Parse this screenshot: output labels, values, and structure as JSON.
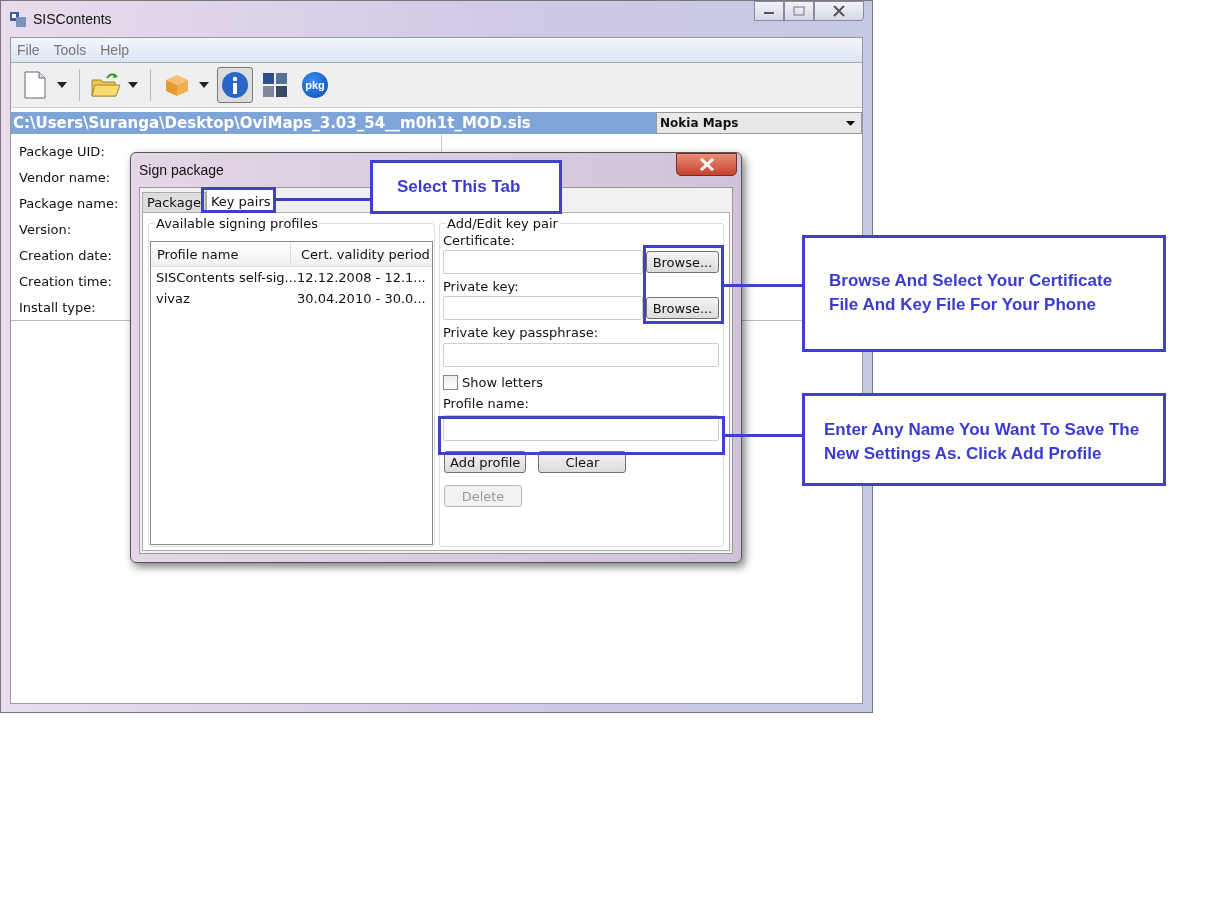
{
  "window": {
    "title": "SISContents",
    "menu": [
      "File",
      "Tools",
      "Help"
    ],
    "toolbar": [
      {
        "kind": "new",
        "dropdown": true,
        "pressed": false
      },
      {
        "kind": "open",
        "dropdown": true,
        "pressed": false
      },
      {
        "kind": "box",
        "dropdown": true,
        "pressed": false
      },
      {
        "kind": "info",
        "dropdown": false,
        "pressed": true
      },
      {
        "kind": "tiles",
        "dropdown": false,
        "pressed": false
      },
      {
        "kind": "pkg",
        "label": "pkg",
        "dropdown": false,
        "pressed": false
      }
    ],
    "path": "C:\\Users\\Suranga\\Desktop\\OviMaps_3.03_54__m0h1t_MOD.sis",
    "package_select": "Nokia Maps",
    "fields": [
      {
        "label": "Package UID:"
      },
      {
        "label": "Vendor name:"
      },
      {
        "label": "Package name:"
      },
      {
        "label": "Version:"
      },
      {
        "label": "Creation date:"
      },
      {
        "label": "Creation time:"
      },
      {
        "label": "Install type:"
      }
    ]
  },
  "dialog": {
    "title": "Sign package",
    "tabs": [
      {
        "label": "Package",
        "selected": false
      },
      {
        "label": "Key pairs",
        "selected": true
      }
    ],
    "profiles": {
      "title": "Available signing profiles",
      "columns": [
        "Profile name",
        "Cert. validity period"
      ],
      "rows": [
        [
          "SISContents self-sig...",
          "12.12.2008 - 12.1..."
        ],
        [
          "vivaz",
          "30.04.2010 - 30.0..."
        ]
      ]
    },
    "keypair": {
      "title": "Add/Edit key pair",
      "certificate_label": "Certificate:",
      "browse_certificate": "Browse...",
      "private_key_label": "Private key:",
      "browse_key": "Browse...",
      "passphrase_label": "Private key passphrase:",
      "show_letters": {
        "label": "Show letters",
        "checked": false
      },
      "profile_name_label": "Profile name:",
      "buttons": [
        {
          "label": "Add profile",
          "disabled": false
        },
        {
          "label": "Clear",
          "disabled": false
        },
        {
          "label": "Delete",
          "disabled": true
        }
      ]
    }
  },
  "callouts": [
    {
      "text": "Select This Tab"
    },
    {
      "text": "Browse And Select Your Certificate File And Key File For Your Phone"
    },
    {
      "text": "Enter Any Name You Want To Save The New Settings As. Click Add Profile"
    }
  ]
}
